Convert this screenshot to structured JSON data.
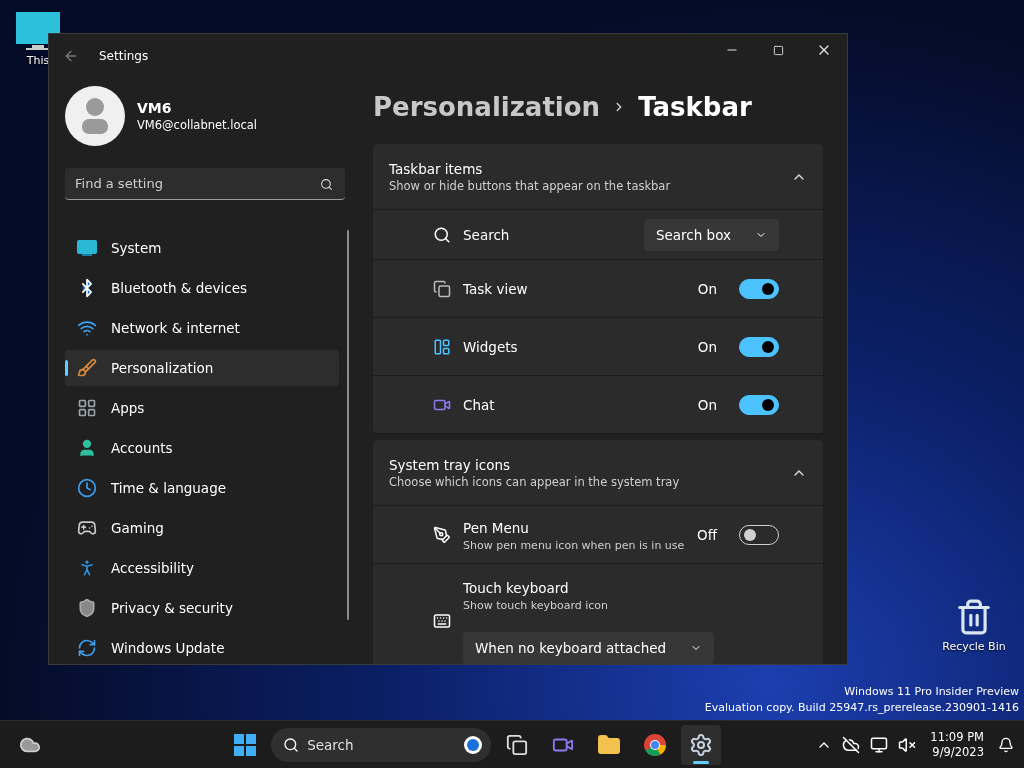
{
  "desktop_icons": [
    {
      "kind": "pc",
      "label": "This"
    },
    {
      "kind": "bin",
      "label": "Recycle Bin"
    }
  ],
  "window": {
    "title": "Settings"
  },
  "account": {
    "name": "VM6",
    "email": "VM6@collabnet.local"
  },
  "search": {
    "placeholder": "Find a setting"
  },
  "nav": [
    {
      "kind": "system",
      "label": "System",
      "selected": false
    },
    {
      "kind": "bluetooth",
      "label": "Bluetooth & devices",
      "selected": false
    },
    {
      "kind": "network",
      "label": "Network & internet",
      "selected": false
    },
    {
      "kind": "personalization",
      "label": "Personalization",
      "selected": true
    },
    {
      "kind": "apps",
      "label": "Apps",
      "selected": false
    },
    {
      "kind": "accounts",
      "label": "Accounts",
      "selected": false
    },
    {
      "kind": "time",
      "label": "Time & language",
      "selected": false
    },
    {
      "kind": "gaming",
      "label": "Gaming",
      "selected": false
    },
    {
      "kind": "accessibility",
      "label": "Accessibility",
      "selected": false
    },
    {
      "kind": "privacy",
      "label": "Privacy & security",
      "selected": false
    },
    {
      "kind": "update",
      "label": "Windows Update",
      "selected": false
    }
  ],
  "breadcrumb": [
    "Personalization",
    "Taskbar"
  ],
  "sections": [
    {
      "title": "Taskbar items",
      "subtitle": "Show or hide buttons that appear on the taskbar",
      "expanded": true,
      "rows": [
        {
          "kind": "dropdown",
          "label": "Search",
          "value": "Search box"
        },
        {
          "kind": "toggle",
          "label": "Task view",
          "state_text": "On",
          "on": true
        },
        {
          "kind": "toggle",
          "label": "Widgets",
          "state_text": "On",
          "on": true
        },
        {
          "kind": "toggle",
          "label": "Chat",
          "state_text": "On",
          "on": true
        }
      ]
    },
    {
      "title": "System tray icons",
      "subtitle": "Choose which icons can appear in the system tray",
      "expanded": true,
      "rows": [
        {
          "kind": "toggle",
          "label": "Pen Menu",
          "description": "Show pen menu icon when pen is in use",
          "state_text": "Off",
          "on": false
        },
        {
          "kind": "dropdown_below",
          "label": "Touch keyboard",
          "description": "Show touch keyboard icon",
          "value": "When no keyboard attached"
        }
      ]
    }
  ],
  "build_info": [
    "Windows 11 Pro Insider Preview",
    "Evaluation copy. Build 25947.rs_prerelease.230901-1416"
  ],
  "taskbar": {
    "search_placeholder": "Search",
    "apps": [
      {
        "kind": "taskview",
        "selected": false
      },
      {
        "kind": "chat",
        "selected": false
      },
      {
        "kind": "explorer",
        "selected": false
      },
      {
        "kind": "chrome",
        "selected": false
      },
      {
        "kind": "settings",
        "selected": true
      }
    ],
    "time": "11:09 PM",
    "date": "9/9/2023"
  }
}
